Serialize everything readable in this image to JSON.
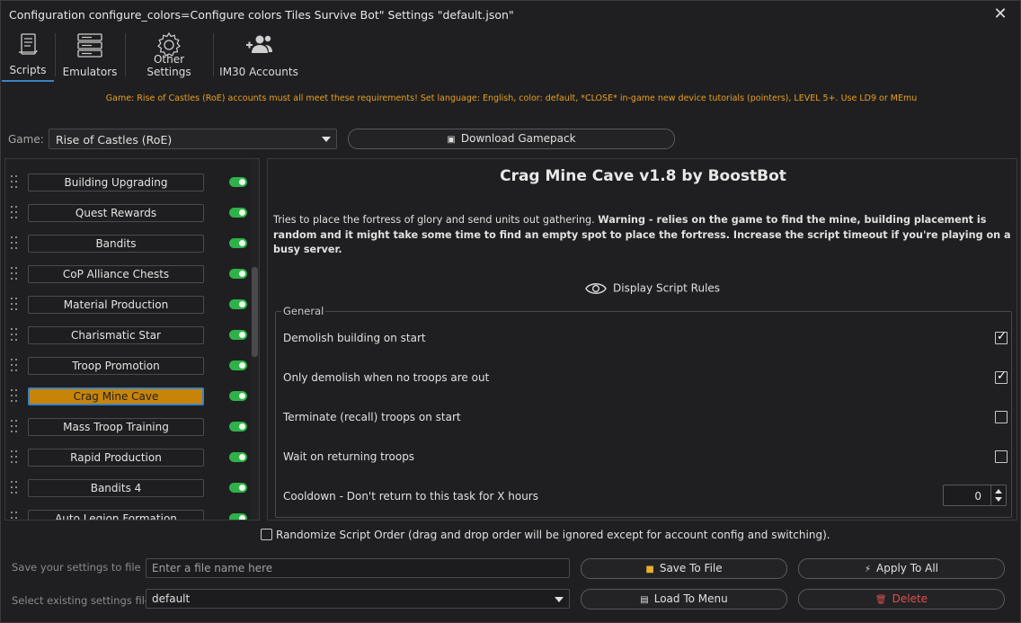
{
  "window": {
    "title": "Configuration configure_colors=Configure colors Tiles Survive Bot\" Settings \"default.json\"",
    "close_glyph": "✕"
  },
  "tabs": [
    {
      "label": "Scripts",
      "icon": "scroll-icon"
    },
    {
      "label": "Emulators",
      "icon": "server-icon"
    },
    {
      "label": "Other Settings",
      "icon": "gear-icon"
    },
    {
      "label": "IM30 Accounts",
      "icon": "users-add-icon"
    }
  ],
  "notice": "Game: Rise of Castles (RoE) accounts must all meet these requirements! Set language: English, color: default, *CLOSE* in-game new device tutorials (pointers), LEVEL 5+. Use LD9 or MEmu",
  "game": {
    "label": "Game:",
    "selected": "Rise of Castles (RoE)",
    "download_label": "Download Gamepack"
  },
  "scripts": [
    {
      "label": "Building Upgrading",
      "enabled": true,
      "active": false
    },
    {
      "label": "Quest Rewards",
      "enabled": true,
      "active": false
    },
    {
      "label": "Bandits",
      "enabled": true,
      "active": false
    },
    {
      "label": "CoP Alliance Chests",
      "enabled": true,
      "active": false
    },
    {
      "label": "Material Production",
      "enabled": true,
      "active": false
    },
    {
      "label": "Charismatic Star",
      "enabled": true,
      "active": false
    },
    {
      "label": "Troop Promotion",
      "enabled": true,
      "active": false
    },
    {
      "label": "Crag Mine Cave",
      "enabled": true,
      "active": true
    },
    {
      "label": "Mass Troop Training",
      "enabled": true,
      "active": false
    },
    {
      "label": "Rapid Production",
      "enabled": true,
      "active": false
    },
    {
      "label": "Bandits 4",
      "enabled": true,
      "active": false
    },
    {
      "label": "Auto Legion Formation",
      "enabled": true,
      "active": false
    }
  ],
  "detail": {
    "title": "Crag Mine Cave v1.8 by BoostBot",
    "desc_plain": "Tries to place the fortress of glory and send units out gathering.",
    "desc_bold": "Warning - relies on the game to find the mine, building placement is random and it might take some time to find an empty spot to place the fortress. Increase the script timeout if you're playing on a busy server.",
    "rules_label": "Display Script Rules",
    "group_title": "General",
    "options": [
      {
        "label": "Demolish building on start",
        "type": "checkbox",
        "checked": true
      },
      {
        "label": "Only demolish when no troops are out",
        "type": "checkbox",
        "checked": true
      },
      {
        "label": "Terminate (recall) troops on start",
        "type": "checkbox",
        "checked": false
      },
      {
        "label": "Wait on returning troops",
        "type": "checkbox",
        "checked": false
      },
      {
        "label": "Cooldown - Don't return to this task for X hours",
        "type": "number",
        "value": "0"
      }
    ]
  },
  "randomize_label": "Randomize Script Order (drag and drop order will be ignored except for account config and switching).",
  "bottom": {
    "save_label": "Save your settings to file",
    "file_placeholder": "Enter a file name here",
    "save_button": "Save To File",
    "apply_button": "Apply To All",
    "select_label": "Select existing settings file",
    "selected_file": "default",
    "load_button": "Load To Menu",
    "delete_button": "Delete"
  },
  "colors": {
    "accent": "#3b82c4",
    "active_script": "#c88408",
    "toggle_on": "#2fb14a",
    "notice": "#e8a020",
    "danger": "#e05050"
  }
}
